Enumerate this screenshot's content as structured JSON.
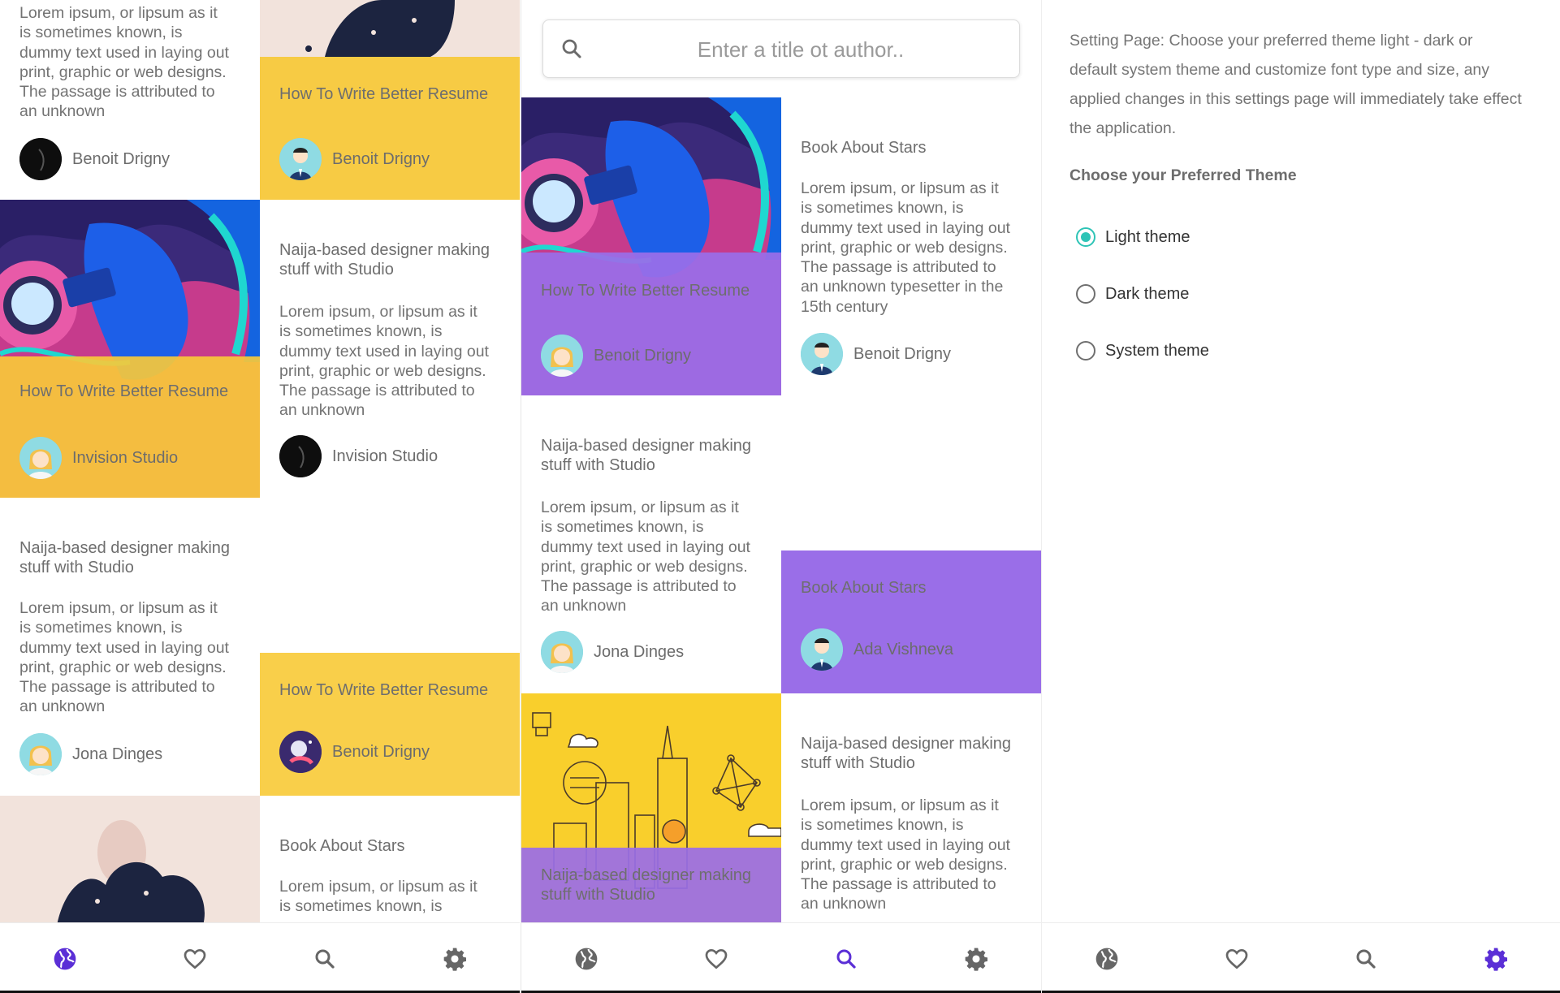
{
  "colors": {
    "accent_purple": "#5b2fd6",
    "yellow_overlay": "#f7c93a",
    "purple_overlay": "#9a6ee8",
    "radio_teal": "#2ec4b6",
    "icon_gray": "#666666"
  },
  "screen1": {
    "col1": {
      "top_card": {
        "body": "Lorem ipsum, or lipsum as it is sometimes known, is dummy text used in laying out print, graphic or web designs. The passage is attributed to an unknown",
        "author": "Benoit Drigny"
      },
      "image_card": {
        "title": "How To Write Better Resume",
        "author": "Invision Studio"
      },
      "text_card": {
        "title": "Naija-based designer making stuff with Studio",
        "body": "Lorem ipsum, or lipsum as it is sometimes known, is dummy text used in laying out print, graphic or web designs. The passage is attributed to an unknown",
        "author": "Jona Dinges"
      }
    },
    "col2": {
      "image_card": {
        "title": "How To Write Better Resume",
        "author": "Benoit Drigny"
      },
      "text_card": {
        "title": "Naija-based designer making stuff with Studio",
        "body": "Lorem ipsum, or lipsum as it is sometimes known, is dummy text used in laying out print, graphic or web designs. The passage is attributed to an unknown",
        "author": "Invision Studio"
      },
      "yellow_card": {
        "title": "How To Write Better Resume",
        "author": "Benoit Drigny"
      },
      "bottom_card": {
        "title": "Book About Stars",
        "body": "Lorem ipsum, or lipsum as it is sometimes known, is"
      }
    }
  },
  "screen2": {
    "search": {
      "placeholder": "Enter a title ot author.."
    },
    "col1": {
      "image_card": {
        "title": "How To Write Better Resume",
        "author": "Benoit Drigny"
      },
      "text_card": {
        "title": "Naija-based designer making stuff with Studio",
        "body": "Lorem ipsum, or lipsum as it is sometimes known, is dummy text used in laying out print, graphic or web designs. The passage is attributed to an unknown",
        "author": "Jona Dinges"
      },
      "city_card": {
        "title": "Naija-based designer making stuff with Studio"
      }
    },
    "col2": {
      "text_card": {
        "title": "Book About Stars",
        "body": "Lorem ipsum, or lipsum as it is sometimes known, is dummy text used in laying out print, graphic or web designs. The passage is attributed to an unknown typesetter in the 15th century",
        "author": "Benoit Drigny"
      },
      "purple_card": {
        "title": "Book About Stars",
        "author": "Ada Vishneva"
      },
      "text_card2": {
        "title": "Naija-based designer making stuff with Studio",
        "body": "Lorem ipsum, or lipsum as it is sometimes known, is dummy text used in laying out print, graphic or web designs. The passage is attributed to an unknown"
      }
    }
  },
  "screen3": {
    "description": "Setting Page: Choose your preferred theme light - dark or default system theme and customize font type and size, any applied changes in this settings page will immediately take effect the application.",
    "heading": "Choose your Preferred Theme",
    "options": [
      {
        "label": "Light theme",
        "checked": true
      },
      {
        "label": "Dark theme",
        "checked": false
      },
      {
        "label": "System theme",
        "checked": false
      }
    ]
  },
  "nav": {
    "icons": [
      "globe-icon",
      "heart-icon",
      "search-icon",
      "gear-icon"
    ],
    "active": {
      "screen1": "globe-icon",
      "screen2": "search-icon",
      "screen3": "gear-icon"
    }
  }
}
